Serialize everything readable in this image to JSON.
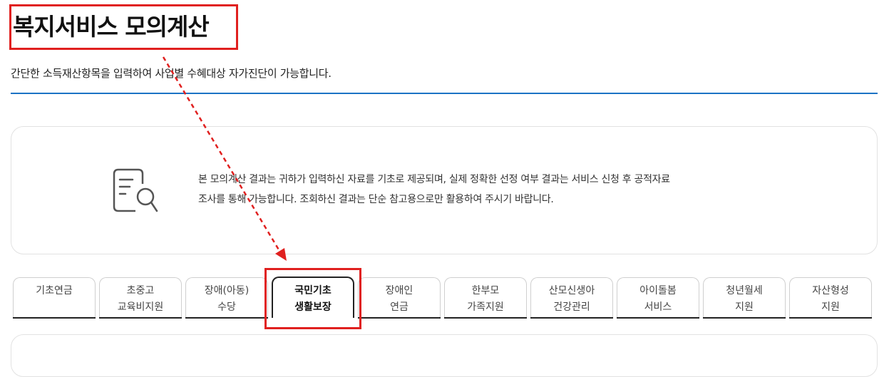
{
  "header": {
    "title": "복지서비스 모의계산",
    "subtitle": "간단한 소득재산항목을 입력하여 사업별 수혜대상 자가진단이 가능합니다."
  },
  "notice": {
    "icon": "document-search-icon",
    "line1": "본 모의계산 결과는 귀하가 입력하신 자료를 기초로 제공되며, 실제 정확한 선정 여부 결과는 서비스 신청 후 공적자료",
    "line2": "조사를 통해 가능합니다. 조회하신 결과는 단순 참고용으로만 활용하여 주시기 바랍니다."
  },
  "tabs": [
    {
      "line1": "기초연금",
      "line2": ""
    },
    {
      "line1": "초중고",
      "line2": "교육비지원"
    },
    {
      "line1": "장애(아동)",
      "line2": "수당"
    },
    {
      "line1": "국민기초",
      "line2": "생활보장",
      "active": true
    },
    {
      "line1": "장애인",
      "line2": "연금"
    },
    {
      "line1": "한부모",
      "line2": "가족지원"
    },
    {
      "line1": "산모신생아",
      "line2": "건강관리"
    },
    {
      "line1": "아이돌봄",
      "line2": "서비스"
    },
    {
      "line1": "청년월세",
      "line2": "지원"
    },
    {
      "line1": "자산형성",
      "line2": "지원"
    }
  ],
  "annotation": {
    "color": "#e0201f"
  }
}
